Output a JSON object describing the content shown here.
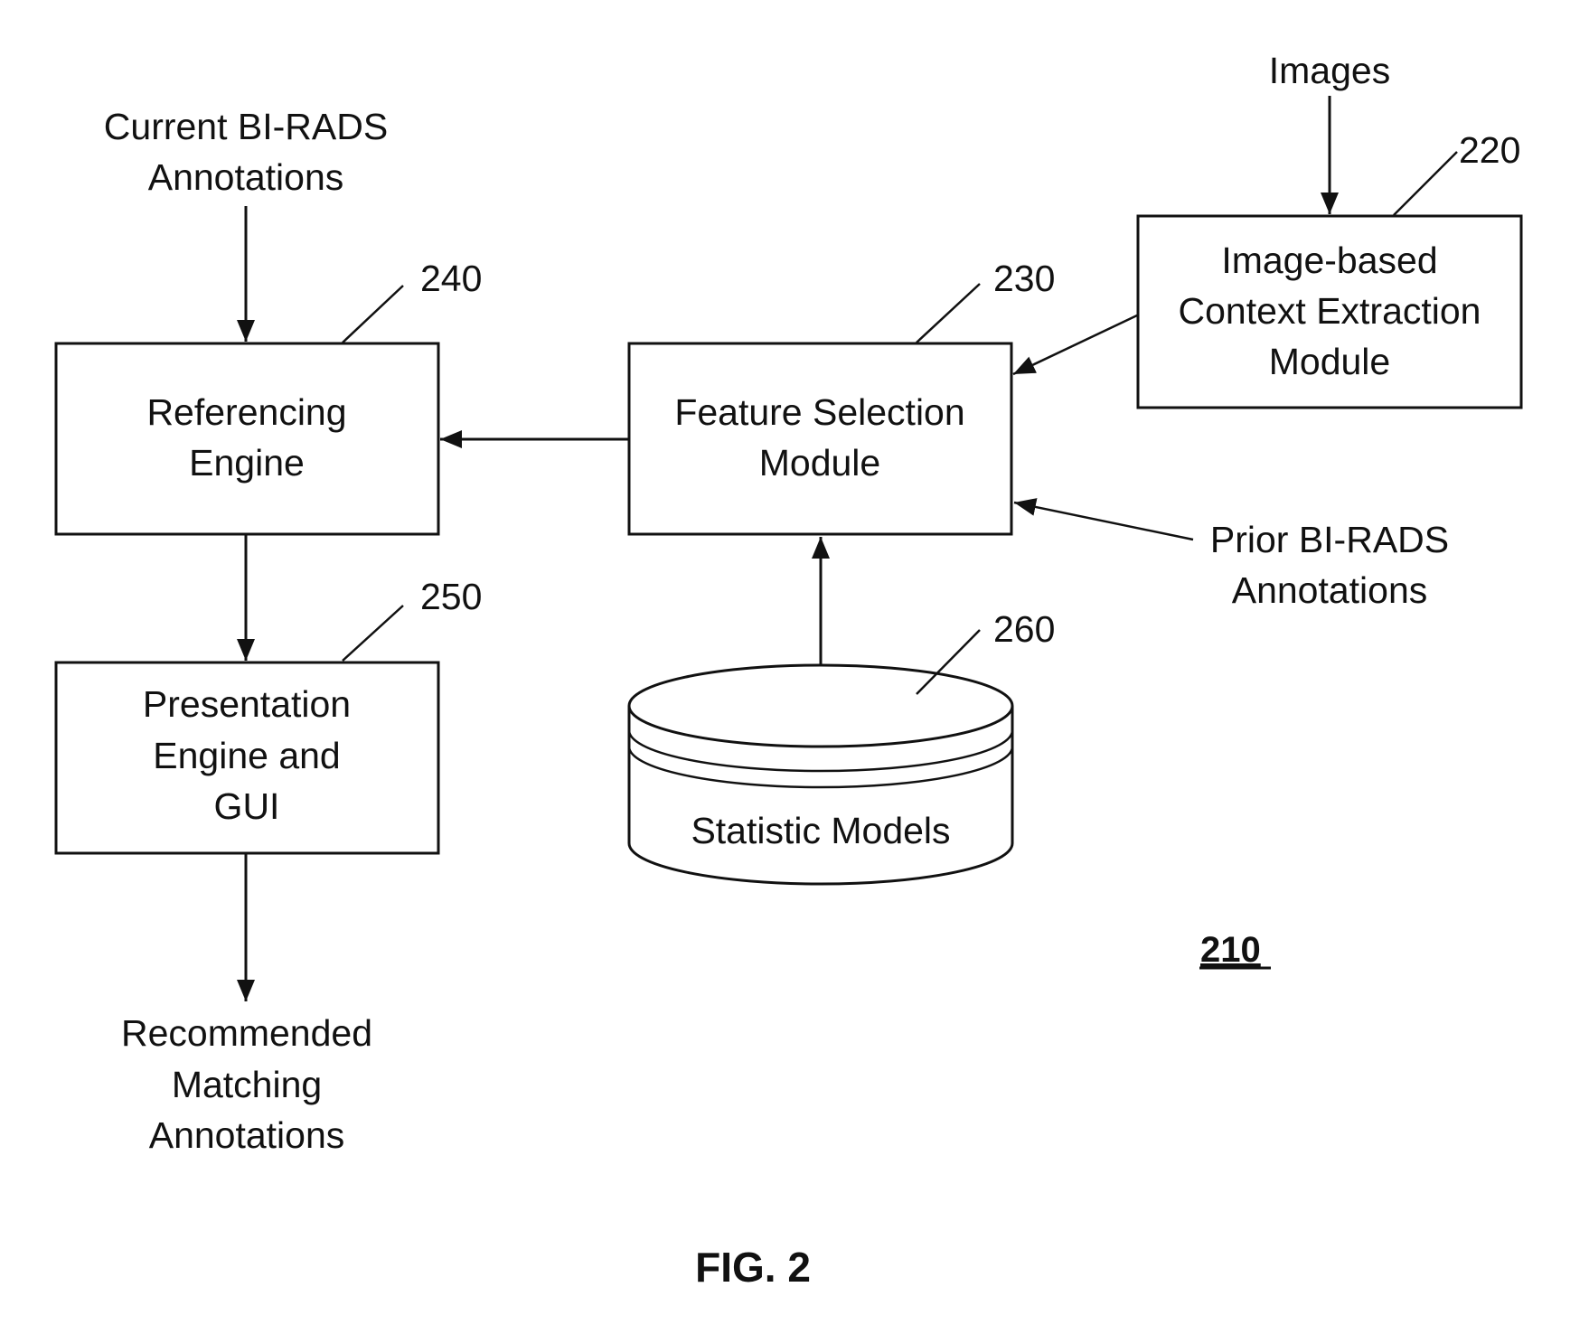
{
  "diagram": {
    "inputs": {
      "current_birads": [
        "Current BI-RADS",
        "Annotations"
      ],
      "images": "Images",
      "prior_birads": [
        "Prior BI-RADS",
        "Annotations"
      ]
    },
    "blocks": {
      "referencing_engine": {
        "lines": [
          "Referencing",
          "Engine"
        ],
        "ref": "240"
      },
      "presentation_engine": {
        "lines": [
          "Presentation",
          "Engine and",
          "GUI"
        ],
        "ref": "250"
      },
      "feature_selection": {
        "lines": [
          "Feature Selection",
          "Module"
        ],
        "ref": "230"
      },
      "context_extraction": {
        "lines": [
          "Image-based",
          "Context Extraction",
          "Module"
        ],
        "ref": "220"
      },
      "statistic_models": {
        "label": "Statistic Models",
        "ref": "260"
      }
    },
    "output": [
      "Recommended",
      "Matching",
      "Annotations"
    ],
    "system_ref": "210",
    "figure_label": "FIG. 2",
    "edges": [
      {
        "from": "Current BI-RADS Annotations",
        "to": "Referencing Engine"
      },
      {
        "from": "Referencing Engine",
        "to": "Presentation Engine and GUI"
      },
      {
        "from": "Presentation Engine and GUI",
        "to": "Recommended Matching Annotations"
      },
      {
        "from": "Feature Selection Module",
        "to": "Referencing Engine"
      },
      {
        "from": "Images",
        "to": "Image-based Context Extraction Module"
      },
      {
        "from": "Image-based Context Extraction Module",
        "to": "Feature Selection Module"
      },
      {
        "from": "Prior BI-RADS Annotations",
        "to": "Feature Selection Module"
      },
      {
        "from": "Statistic Models",
        "to": "Feature Selection Module"
      }
    ]
  }
}
